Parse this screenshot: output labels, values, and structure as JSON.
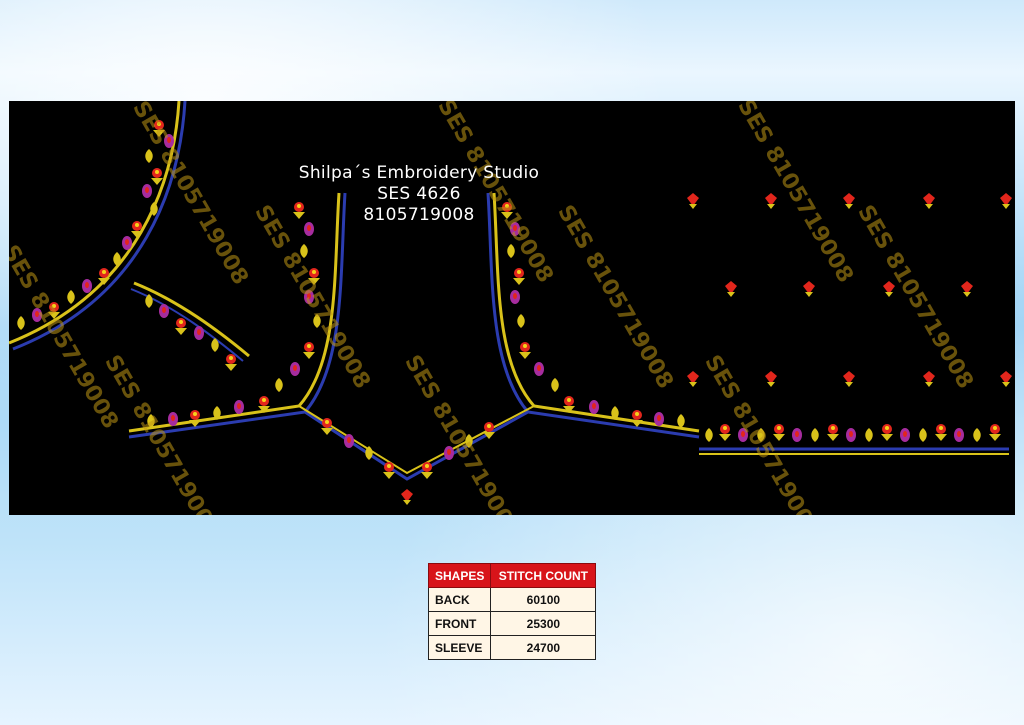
{
  "design": {
    "studio_name": "Shilpa´s Embroidery Studio",
    "design_code": "SES  4626",
    "phone": "8105719008",
    "watermark": "SES 8105719008",
    "colors": {
      "background": "#000000",
      "gold": "#d9c21a",
      "magenta": "#a62c9e",
      "red": "#e2261c",
      "blue": "#2b3cb0"
    }
  },
  "stitch_table": {
    "headers": [
      "SHAPES",
      "STITCH COUNT"
    ],
    "rows": [
      {
        "shape": "BACK",
        "count": "60100"
      },
      {
        "shape": "FRONT",
        "count": "25300"
      },
      {
        "shape": "SLEEVE",
        "count": "24700"
      }
    ],
    "header_color": "#d8141a",
    "row_color": "#fff6e6"
  }
}
